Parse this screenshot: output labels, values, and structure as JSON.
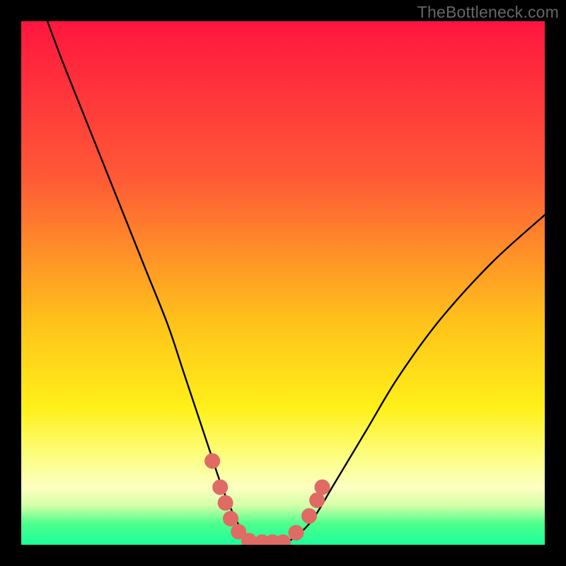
{
  "watermark": "TheBottleneck.com",
  "chart_data": {
    "type": "line",
    "title": "",
    "xlabel": "",
    "ylabel": "",
    "xlim": [
      0,
      100
    ],
    "ylim": [
      0,
      100
    ],
    "series": [
      {
        "name": "bottleneck-curve",
        "x": [
          5,
          8,
          12,
          16,
          20,
          24,
          28,
          31,
          34,
          36,
          38,
          40,
          42,
          44,
          46,
          48,
          50,
          55,
          60,
          66,
          72,
          80,
          90,
          100
        ],
        "y": [
          100,
          92,
          82,
          72,
          62,
          52,
          42,
          33,
          24,
          18,
          12,
          7,
          3,
          1,
          0,
          0,
          0,
          4,
          12,
          22,
          32,
          43,
          54,
          63
        ]
      }
    ],
    "markers": {
      "name": "highlight-dots",
      "color": "#e06a64",
      "points": [
        {
          "x": 36.5,
          "y": 16
        },
        {
          "x": 38.0,
          "y": 11
        },
        {
          "x": 39.0,
          "y": 8
        },
        {
          "x": 40.0,
          "y": 5
        },
        {
          "x": 41.5,
          "y": 2.5
        },
        {
          "x": 43.5,
          "y": 0.8
        },
        {
          "x": 46.0,
          "y": 0.5
        },
        {
          "x": 48.0,
          "y": 0.5
        },
        {
          "x": 50.0,
          "y": 0.5
        },
        {
          "x": 52.5,
          "y": 2.3
        },
        {
          "x": 55.0,
          "y": 5.5
        },
        {
          "x": 56.5,
          "y": 8.5
        },
        {
          "x": 57.5,
          "y": 11
        }
      ]
    }
  }
}
